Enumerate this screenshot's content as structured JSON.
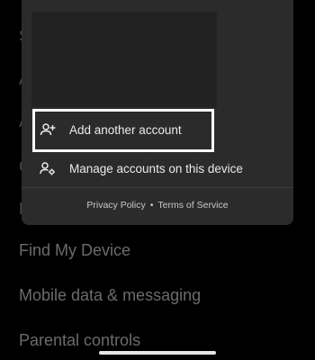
{
  "sheet": {
    "menu": {
      "add_account": {
        "label": "Add another account",
        "icon": "add-person-icon"
      },
      "manage_accounts": {
        "label": "Manage accounts on this device",
        "icon": "manage-accounts-icon"
      }
    },
    "footer": {
      "privacy": "Privacy Policy",
      "separator": "•",
      "terms": "Terms of Service"
    }
  },
  "background_list": {
    "items": [
      {
        "label": "Find My Device"
      },
      {
        "label": "Mobile data & messaging"
      },
      {
        "label": "Parental controls"
      }
    ]
  },
  "colors": {
    "background": "#000000",
    "sheet": "#2b2b2b",
    "highlight_border": "#ffffff",
    "text_primary": "#eaeaea",
    "text_dimmed": "#6b6b6b"
  }
}
